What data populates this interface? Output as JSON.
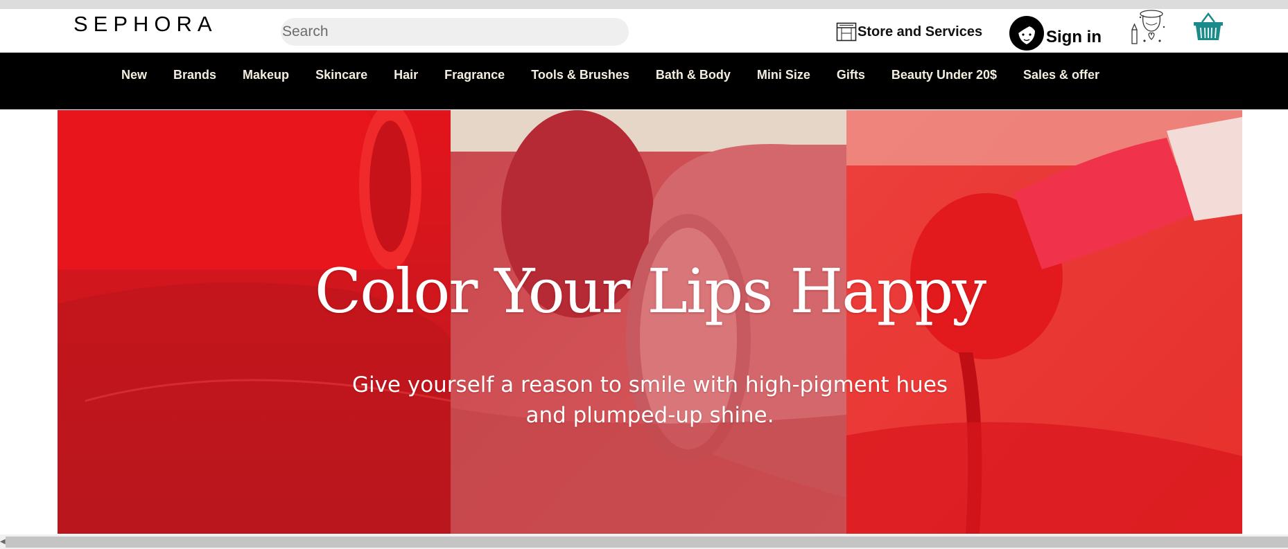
{
  "header": {
    "logo_text": "SEPHORA",
    "search_placeholder": "Search",
    "store_label": "Store and Services",
    "signin_label": "Sign in"
  },
  "nav": {
    "items": [
      {
        "label": "New"
      },
      {
        "label": "Brands"
      },
      {
        "label": "Makeup"
      },
      {
        "label": "Skincare"
      },
      {
        "label": "Hair"
      },
      {
        "label": "Fragrance"
      },
      {
        "label": "Tools & Brushes"
      },
      {
        "label": "Bath & Body"
      },
      {
        "label": "Mini Size"
      },
      {
        "label": "Gifts"
      },
      {
        "label": "Beauty Under 20$"
      },
      {
        "label": "Sales & offer"
      }
    ]
  },
  "hero": {
    "title": "Color Your Lips Happy",
    "subtitle_line1": "Give yourself a reason to smile with high-pigment hues",
    "subtitle_line2": "and plumped-up shine."
  },
  "icons": {
    "store": "store-icon",
    "avatar": "avatar-icon",
    "beauty_profile": "beauty-profile-icon",
    "basket": "basket-icon"
  },
  "colors": {
    "nav_background": "#000000",
    "nav_text": "#f3eee0",
    "search_background": "#efefef",
    "hero_red": "#d8262b",
    "basket_teal": "#1a8a8a"
  }
}
